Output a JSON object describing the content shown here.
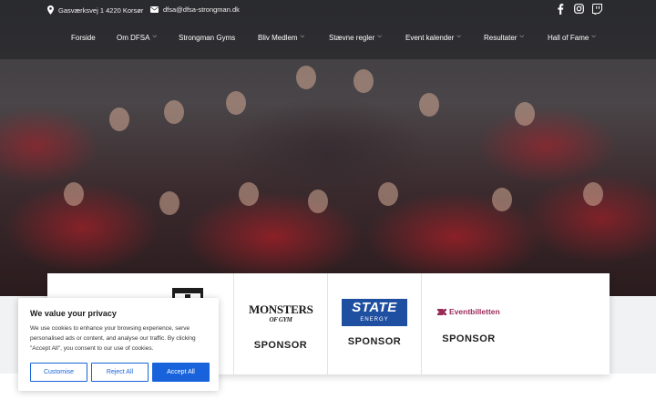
{
  "topbar": {
    "address": "Gasværksvej 1 4220 Korsør",
    "email": "dfsa@dfsa-strongman.dk",
    "social_icons": [
      "facebook-icon",
      "instagram-icon",
      "twitch-icon"
    ]
  },
  "nav": {
    "items": [
      {
        "label": "Forside",
        "has_dropdown": false
      },
      {
        "label": "Om DFSA",
        "has_dropdown": true
      },
      {
        "label": "Strongman Gyms",
        "has_dropdown": false
      },
      {
        "label": "Bliv Medlem",
        "has_dropdown": true
      },
      {
        "label": "Stævne regler",
        "has_dropdown": true
      },
      {
        "label": "Event kalender",
        "has_dropdown": true
      },
      {
        "label": "Resultater",
        "has_dropdown": true
      },
      {
        "label": "Hall of Fame",
        "has_dropdown": true
      }
    ]
  },
  "sponsors": [
    {
      "logo": "tt-logo",
      "label": ""
    },
    {
      "logo": "monsters-of-gym-logo",
      "logo_text": "MONSTERS",
      "logo_sub": "OF GYM",
      "label": "SPONSOR"
    },
    {
      "logo": "state-energy-logo",
      "logo_text": "STATE",
      "logo_sub": "ENERGY",
      "label": "SPONSOR"
    },
    {
      "logo": "eventbilletten-logo",
      "logo_text": "Eventbilletten",
      "label": "SPONSOR"
    }
  ],
  "cookie": {
    "title": "We value your privacy",
    "body": "We use cookies to enhance your browsing experience, serve personalised ads or content, and analyse our traffic. By clicking \"Accept All\", you consent to our use of cookies.",
    "customise_label": "Customise",
    "reject_label": "Reject All",
    "accept_label": "Accept All"
  },
  "colors": {
    "accent_blue": "#1863dc",
    "state_blue": "#1f4fa0",
    "event_purple": "#9b2a58"
  }
}
